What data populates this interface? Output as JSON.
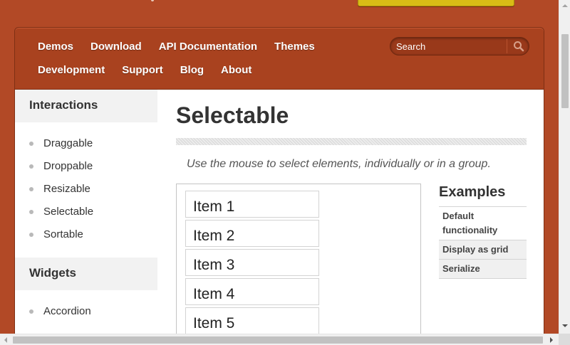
{
  "nav": {
    "row1": [
      "Demos",
      "Download",
      "API Documentation",
      "Themes"
    ],
    "row2": [
      "Development",
      "Support",
      "Blog",
      "About"
    ],
    "search_placeholder": "Search",
    "search_icon": "magnifier-icon"
  },
  "sidebar": {
    "sections": [
      {
        "title": "Interactions",
        "items": [
          "Draggable",
          "Droppable",
          "Resizable",
          "Selectable",
          "Sortable"
        ]
      },
      {
        "title": "Widgets",
        "items": [
          "Accordion"
        ]
      }
    ]
  },
  "main": {
    "title": "Selectable",
    "intro": "Use the mouse to select elements, individually or in a group.",
    "demo_items": [
      "Item 1",
      "Item 2",
      "Item 3",
      "Item 4",
      "Item 5"
    ],
    "examples_title": "Examples",
    "examples": [
      "Default functionality",
      "Display as grid",
      "Serialize"
    ]
  },
  "colors": {
    "page_background": "#b24926",
    "nav_background": "#a9421f",
    "banner_button": "#d9bc16",
    "text_dark": "#333333"
  }
}
